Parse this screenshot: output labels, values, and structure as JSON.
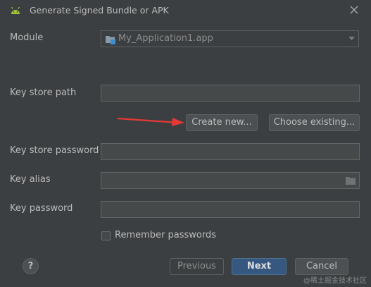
{
  "window": {
    "title": "Generate Signed Bundle or APK"
  },
  "icons": {
    "app": "android-icon",
    "close": "close-icon",
    "module": "module-folder-icon",
    "dropdown": "chevron-down-icon",
    "browse": "folder-icon",
    "help": "help-icon",
    "annotation": "red-arrow"
  },
  "form": {
    "module_label": "Module",
    "module_value": "My_Application1.app",
    "key_store_path_label": "Key store path",
    "key_store_path_value": "",
    "key_store_password_label": "Key store password",
    "key_store_password_value": "",
    "key_alias_label": "Key alias",
    "key_alias_value": "",
    "key_password_label": "Key password",
    "key_password_value": "",
    "remember_label": "Remember passwords",
    "remember_checked": false
  },
  "keystore_buttons": {
    "create_new": "Create new...",
    "choose_existing": "Choose existing..."
  },
  "footer": {
    "help": "?",
    "previous": "Previous",
    "next": "Next",
    "cancel": "Cancel"
  },
  "watermark": "@稀土掘金技术社区",
  "colors": {
    "background": "#3c3f41",
    "field_background": "#45494a",
    "primary_button": "#365880",
    "android_green": "#a4c639",
    "annotation_arrow": "#e53935",
    "module_icon_blue": "#3d8bd1"
  }
}
